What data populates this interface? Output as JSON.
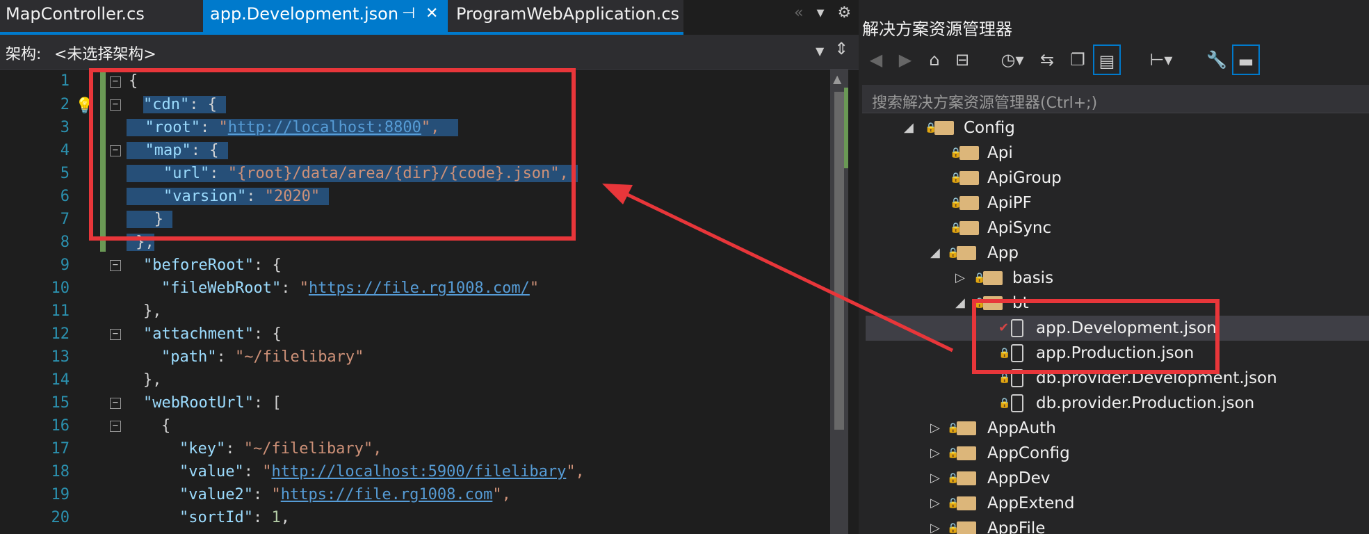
{
  "tabs": [
    {
      "label": "MapController.cs",
      "active": false
    },
    {
      "label": "app.Development.json",
      "active": true
    },
    {
      "label": "ProgramWebApplication.cs",
      "active": false
    }
  ],
  "editor": {
    "frame_label": "架构:",
    "frame_value": "<未选择架构>",
    "line_numbers": [
      "1",
      "2",
      "3",
      "4",
      "5",
      "6",
      "7",
      "8",
      "9",
      "10",
      "11",
      "12",
      "13",
      "14",
      "15",
      "16",
      "17",
      "18",
      "19",
      "20"
    ]
  },
  "solution_explorer": {
    "title": "解决方案资源管理器",
    "search_placeholder": "搜索解决方案资源管理器(Ctrl+;)",
    "nodes": [
      {
        "label": "Config"
      },
      {
        "label": "Api"
      },
      {
        "label": "ApiGroup"
      },
      {
        "label": "ApiPF"
      },
      {
        "label": "ApiSync"
      },
      {
        "label": "App"
      },
      {
        "label": "basis"
      },
      {
        "label": "bt"
      },
      {
        "label": "app.Development.json"
      },
      {
        "label": "app.Production.json"
      },
      {
        "label": "db.provider.Development.json"
      },
      {
        "label": "db.provider.Production.json"
      },
      {
        "label": "AppAuth"
      },
      {
        "label": "AppConfig"
      },
      {
        "label": "AppDev"
      },
      {
        "label": "AppExtend"
      },
      {
        "label": "AppFile"
      }
    ]
  },
  "code": {
    "l1": "{",
    "l2k": "\"cdn\"",
    "l2p": ": {",
    "l3k": "\"root\"",
    "l3p": ": ",
    "l3q1": "\"",
    "l3u": "http://localhost:8800",
    "l3q2": "\",",
    "l4k": "\"map\"",
    "l4p": ": {",
    "l5k": "\"url\"",
    "l5p": ": ",
    "l5s": "\"{root}/data/area/{dir}/{code}.json\",",
    "l6k": "\"varsion\"",
    "l6p": ": ",
    "l6s": "\"2020\"",
    "l7": "}",
    "l8": "},",
    "l9k": "\"beforeRoot\"",
    "l9p": ": {",
    "l10k": "\"fileWebRoot\"",
    "l10p": ": ",
    "l10q1": "\"",
    "l10u": "https://file.rg1008.com/",
    "l10q2": "\"",
    "l11": "},",
    "l12k": "\"attachment\"",
    "l12p": ": {",
    "l13k": "\"path\"",
    "l13p": ": ",
    "l13s": "\"~/filelibary\"",
    "l14": "},",
    "l15k": "\"webRootUrl\"",
    "l15p": ": [",
    "l16": "{",
    "l17k": "\"key\"",
    "l17p": ": ",
    "l17s": "\"~/filelibary\",",
    "l18k": "\"value\"",
    "l18p": ": ",
    "l18q1": "\"",
    "l18u": "http://localhost:5900/filelibary",
    "l18q2": "\",",
    "l19k": "\"value2\"",
    "l19p": ": ",
    "l19q1": "\"",
    "l19u": "https://file.rg1008.com",
    "l19q2": "\",",
    "l20k": "\"sortId\"",
    "l20p": ": ",
    "l20n": "1",
    "l20c": ","
  },
  "colors": {
    "accent": "#007acc",
    "annotation": "#e8363a"
  }
}
